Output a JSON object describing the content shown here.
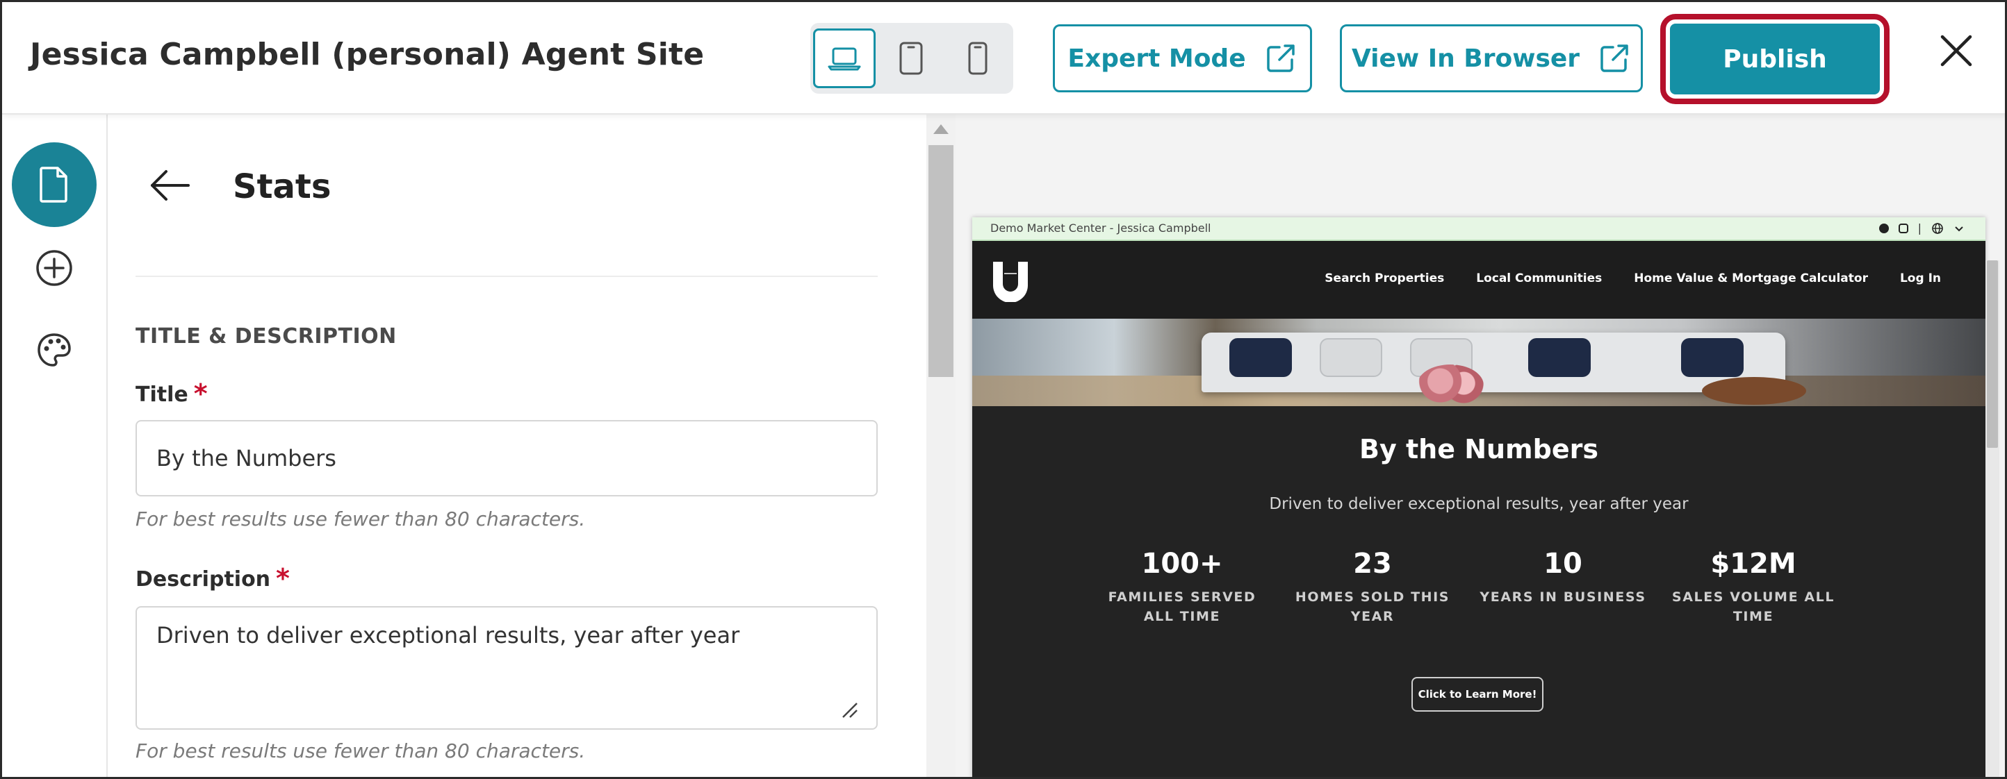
{
  "header": {
    "site_title": "Jessica Campbell (personal) Agent Site",
    "devices": [
      {
        "name": "desktop",
        "icon": "laptop-icon",
        "active": true
      },
      {
        "name": "tablet",
        "icon": "tablet-icon",
        "active": false
      },
      {
        "name": "mobile",
        "icon": "mobile-icon",
        "active": false
      }
    ],
    "expert_mode_label": "Expert Mode",
    "view_in_browser_label": "View In Browser",
    "publish_label": "Publish",
    "accent_color": "#1590a5",
    "highlight_color": "#b5102b"
  },
  "rail": {
    "items": [
      {
        "name": "pages",
        "icon": "page-icon",
        "active": true
      },
      {
        "name": "add",
        "icon": "plus-circle-icon",
        "active": false
      },
      {
        "name": "theme",
        "icon": "palette-icon",
        "active": false
      }
    ]
  },
  "editor": {
    "panel_title": "Stats",
    "section_heading": "TITLE & DESCRIPTION",
    "title_label": "Title",
    "title_value": "By the Numbers",
    "title_hint": "For best results use fewer than 80 characters.",
    "description_label": "Description",
    "description_value": "Driven to deliver exceptional results, year after year",
    "description_hint": "For best results use fewer than 80 characters.",
    "required_marker": "*"
  },
  "preview": {
    "topbar_text": "Demo Market Center - Jessica Campbell",
    "topbar_separator": "|",
    "nav_links": [
      "Search Properties",
      "Local Communities",
      "Home Value & Mortgage Calculator",
      "Log In"
    ],
    "stats_title": "By the Numbers",
    "stats_description": "Driven to deliver exceptional results, year after year",
    "stats": [
      {
        "value": "100+",
        "label": "FAMILIES SERVED ALL TIME"
      },
      {
        "value": "23",
        "label": "HOMES SOLD THIS YEAR"
      },
      {
        "value": "10",
        "label": "YEARS IN BUSINESS"
      },
      {
        "value": "$12M",
        "label": "SALES VOLUME ALL TIME"
      }
    ],
    "cta_label": "Click to Learn More!"
  }
}
